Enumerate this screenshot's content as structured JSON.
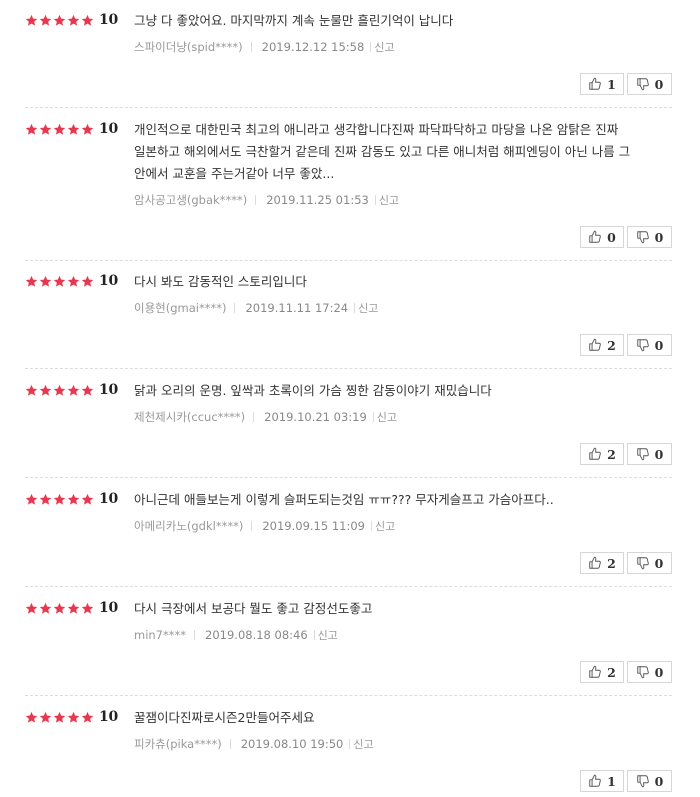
{
  "colors": {
    "star": "#e8384f",
    "text": "#333333",
    "meta": "#999999",
    "border": "#d6d6d6"
  },
  "icons": {
    "star": "star-icon",
    "like": "thumbs-up-icon",
    "dislike": "thumbs-down-icon"
  },
  "reviews": [
    {
      "stars": 5,
      "score": "10",
      "text": "그냥 다 좋았어요. 마지막까지 계속 눈물만 흘린기억이 납니다",
      "author": "스파이더냥(spid****)",
      "date": "2019.12.12 15:58",
      "report": "신고",
      "likes": "1",
      "dislikes": "0"
    },
    {
      "stars": 5,
      "score": "10",
      "text": "개인적으로 대한민국 최고의 애니라고 생각합니다진짜 파닥파닥하고 마당을 나온 암탉은 진짜 일본하고 해외에서도 극찬할거 같은데 진짜 감동도 있고 다른 애니처럼 해피엔딩이 아닌 나름 그 안에서 교훈을 주는거같아 너무 좋았...",
      "author": "암사공고생(gbak****)",
      "date": "2019.11.25 01:53",
      "report": "신고",
      "likes": "0",
      "dislikes": "0"
    },
    {
      "stars": 5,
      "score": "10",
      "text": "다시 봐도 감동적인 스토리입니다",
      "author": "이용현(gmai****)",
      "date": "2019.11.11 17:24",
      "report": "신고",
      "likes": "2",
      "dislikes": "0"
    },
    {
      "stars": 5,
      "score": "10",
      "text": "닭과 오리의 운명. 잎싹과 초록이의 가슴 찡한 감동이야기 재밌습니다",
      "author": "제천제시카(ccuc****)",
      "date": "2019.10.21 03:19",
      "report": "신고",
      "likes": "2",
      "dislikes": "0"
    },
    {
      "stars": 5,
      "score": "10",
      "text": "아니근데 애들보는게 이렇게 슬퍼도되는것임 ㅠㅠ??? 무자게슬프고 가슴아프다..",
      "author": "아메리카노(gdkl****)",
      "date": "2019.09.15 11:09",
      "report": "신고",
      "likes": "2",
      "dislikes": "0"
    },
    {
      "stars": 5,
      "score": "10",
      "text": "다시 극장에서 보공다 뭘도 좋고 감정선도좋고",
      "author": "min7****",
      "date": "2019.08.18 08:46",
      "report": "신고",
      "likes": "2",
      "dislikes": "0"
    },
    {
      "stars": 5,
      "score": "10",
      "text": "꿀잼이다진짜로시즌2만들어주세요",
      "author": "피카츄(pika****)",
      "date": "2019.08.10 19:50",
      "report": "신고",
      "likes": "1",
      "dislikes": "0"
    }
  ]
}
